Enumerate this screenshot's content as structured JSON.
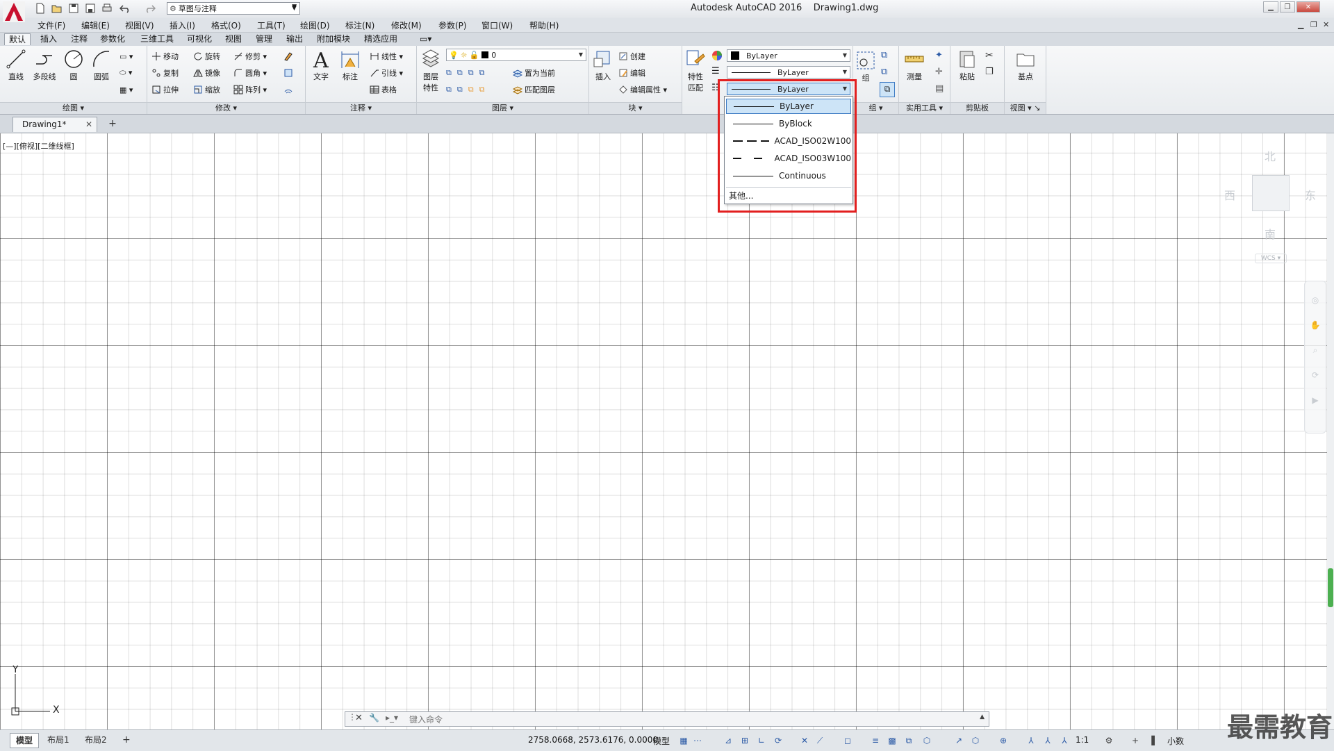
{
  "title_bar": {
    "app_title": "Autodesk AutoCAD 2016",
    "doc_title": "Drawing1.dwg",
    "workspace": "草图与注释"
  },
  "menu": [
    "文件(F)",
    "编辑(E)",
    "视图(V)",
    "插入(I)",
    "格式(O)",
    "工具(T)",
    "绘图(D)",
    "标注(N)",
    "修改(M)",
    "参数(P)",
    "窗口(W)",
    "帮助(H)"
  ],
  "ribbon_tabs": [
    "默认",
    "插入",
    "注释",
    "参数化",
    "三维工具",
    "可视化",
    "视图",
    "管理",
    "输出",
    "附加模块",
    "精选应用"
  ],
  "ribbon": {
    "draw": {
      "title": "绘图",
      "line": "直线",
      "polyline": "多段线",
      "circle": "圆",
      "arc": "圆弧"
    },
    "modify": {
      "title": "修改",
      "move": "移动",
      "rotate": "旋转",
      "trim": "修剪",
      "copy": "复制",
      "mirror": "镜像",
      "fillet": "圆角",
      "stretch": "拉伸",
      "scale": "缩放",
      "array": "阵列"
    },
    "annotation": {
      "title": "注释",
      "text": "文字",
      "dimension": "标注",
      "linear": "线性",
      "leader": "引线",
      "table": "表格"
    },
    "layers": {
      "title": "图层",
      "layer_props_line1": "图层",
      "layer_props_line2": "特性",
      "current_layer": "0",
      "set_current": "置为当前",
      "match_layer": "匹配图层"
    },
    "block": {
      "title": "块",
      "insert": "插入",
      "create": "创建",
      "edit": "编辑",
      "edit_attr": "编辑属性"
    },
    "properties": {
      "match_line1": "特性",
      "match_line2": "匹配",
      "color": "ByLayer",
      "lineweight": "ByLayer",
      "linetype": "ByLayer"
    },
    "groups": {
      "title": "组",
      "group": "组"
    },
    "utilities": {
      "title": "实用工具",
      "measure": "测量"
    },
    "clipboard": {
      "title": "剪贴板",
      "paste": "粘贴"
    },
    "view": {
      "title": "视图",
      "base": "基点"
    }
  },
  "doc_tab": {
    "name": "Drawing1*"
  },
  "viewport_label": "[—][俯视][二维线框]",
  "viewcube": {
    "north": "北",
    "south": "南",
    "east": "东",
    "west": "西",
    "wcs": "WCS"
  },
  "linetype_list": {
    "items": [
      "ByLayer",
      "ByBlock",
      "ACAD_ISO02W100",
      "ACAD_ISO03W100",
      "Continuous"
    ],
    "selected": "ByLayer",
    "other": "其他..."
  },
  "command": {
    "placeholder": "键入命令"
  },
  "ucs": {
    "x": "X",
    "y": "Y"
  },
  "status": {
    "layouts": [
      "模型",
      "布局1",
      "布局2"
    ],
    "coords": "2758.0668, 2573.6176, 0.0000",
    "model": "模型",
    "scale": "1:1",
    "units": "小数"
  },
  "watermark": "最需教育",
  "colors": {
    "highlight": "#e21f1f",
    "selection": "#cde4f7",
    "accent": "#3d7bc4"
  }
}
